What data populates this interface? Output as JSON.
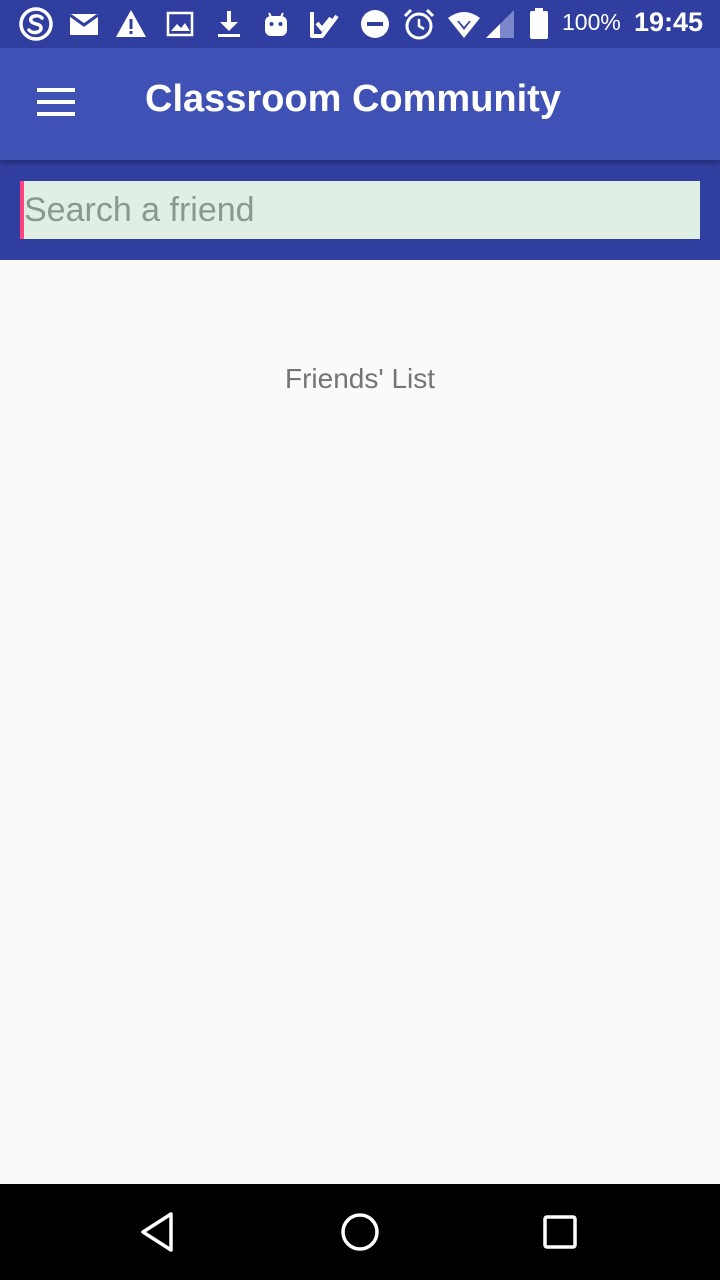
{
  "status_bar": {
    "icons": [
      "s-notification-icon",
      "mail-icon",
      "warning-icon",
      "image-icon",
      "download-icon",
      "android-icon",
      "tasks-icon",
      "do-not-disturb-icon",
      "alarm-icon",
      "wifi-icon",
      "cell-signal-icon",
      "battery-icon"
    ],
    "battery_percent": "100%",
    "time": "19:45"
  },
  "app_bar": {
    "title": "Classroom Community",
    "colors": {
      "primary": "#3f51b5",
      "primary_dark": "#303f9f",
      "accent": "#ff4081"
    }
  },
  "search": {
    "placeholder": "Search a friend",
    "value": ""
  },
  "main": {
    "list_heading": "Friends' List"
  },
  "nav_bar": {
    "buttons": [
      "back-icon",
      "home-icon",
      "recents-icon"
    ]
  }
}
